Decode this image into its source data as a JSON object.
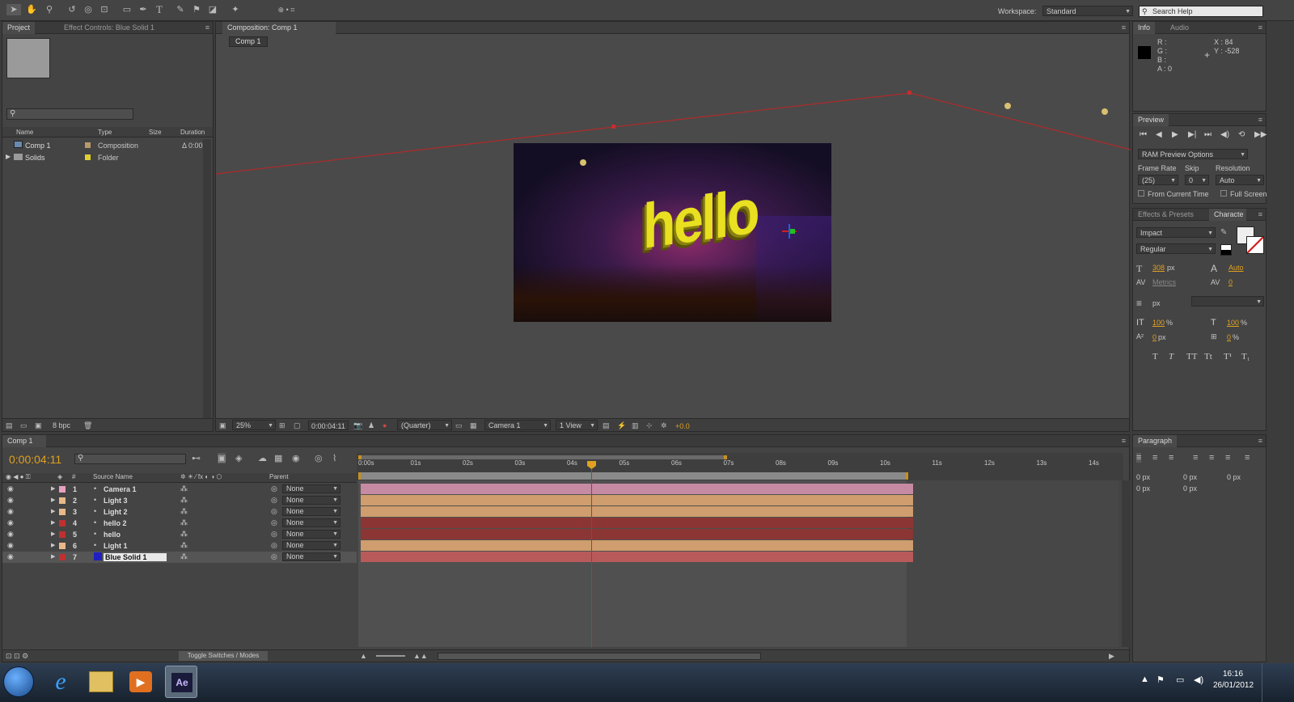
{
  "workspace": {
    "label": "Workspace:",
    "value": "Standard",
    "search_placeholder": "Search Help"
  },
  "project_panel": {
    "tabs": [
      "Project",
      "Effect Controls: Blue Solid 1"
    ],
    "columns": [
      "Name",
      "Type",
      "Size",
      "Duration"
    ],
    "items": [
      {
        "name": "Comp 1",
        "type": "Composition",
        "duration": "Δ 0:00"
      },
      {
        "name": "Solids",
        "type": "Folder",
        "duration": ""
      }
    ],
    "bpc": "8 bpc"
  },
  "composition_panel": {
    "tab": "Composition: Comp 1",
    "sub_tab": "Comp 1",
    "zoom": "25%",
    "timecode": "0:00:04:11",
    "resolution": "(Quarter)",
    "camera": "Camera 1",
    "views": "1 View",
    "exposure": "+0.0",
    "scene_text": "hello"
  },
  "info_panel": {
    "tabs": [
      "Info",
      "Audio"
    ],
    "r": "R :",
    "g": "G :",
    "b": "B :",
    "a": "A : 0",
    "x": "X : 84",
    "y": "Y : -528"
  },
  "preview_panel": {
    "tab": "Preview",
    "options": "RAM Preview Options",
    "frame_rate_label": "Frame Rate",
    "skip_label": "Skip",
    "resolution_label": "Resolution",
    "frame_rate": "(25)",
    "skip": "0",
    "resolution": "Auto",
    "from_current": "From Current Time",
    "full_screen": "Full Screen"
  },
  "character_panel": {
    "tabs": [
      "Effects & Presets",
      "Characte"
    ],
    "font": "Impact",
    "style": "Regular",
    "size": "308",
    "size_unit": "px",
    "leading": "Auto",
    "kerning": "Metrics",
    "tracking": "0",
    "stroke_unit": "px",
    "vscale": "100",
    "vscale_unit": "%",
    "hscale": "100",
    "hscale_unit": "%",
    "baseline": "0",
    "baseline_unit": "px",
    "tsume": "0",
    "tsume_unit": "%",
    "styles": [
      "T",
      "T",
      "TT",
      "Tt",
      "T¹",
      "T₁"
    ]
  },
  "paragraph_panel": {
    "tab": "Paragraph",
    "values": [
      "0 px",
      "0 px",
      "0 px",
      "0 px",
      "0 px"
    ]
  },
  "timeline": {
    "tab": "Comp 1",
    "timecode": "0:00:04:11",
    "col_source": "Source Name",
    "col_parent": "Parent",
    "col_num": "#",
    "toggle_label": "Toggle Switches / Modes",
    "ruler": [
      "0:00s",
      "01s",
      "02s",
      "03s",
      "04s",
      "05s",
      "06s",
      "07s",
      "08s",
      "09s",
      "10s",
      "11s",
      "12s",
      "13s",
      "14s"
    ],
    "layers": [
      {
        "num": "1",
        "name": "Camera 1",
        "label_color": "#e8a0c0",
        "bar_color": "#c78aa3",
        "parent": "None"
      },
      {
        "num": "2",
        "name": "Light 3",
        "label_color": "#e8b888",
        "bar_color": "#cf9d6e",
        "parent": "None"
      },
      {
        "num": "3",
        "name": "Light 2",
        "label_color": "#e8b888",
        "bar_color": "#cf9d6e",
        "parent": "None"
      },
      {
        "num": "4",
        "name": "hello 2",
        "label_color": "#c03030",
        "bar_color": "#8c3535",
        "parent": "None"
      },
      {
        "num": "5",
        "name": "hello",
        "label_color": "#c03030",
        "bar_color": "#8c3535",
        "parent": "None"
      },
      {
        "num": "6",
        "name": "Light 1",
        "label_color": "#e8b888",
        "bar_color": "#cf9d6e",
        "parent": "None"
      },
      {
        "num": "7",
        "name": "Blue Solid 1",
        "label_color": "#c03030",
        "bar_color": "#b85a5a",
        "parent": "None"
      }
    ]
  },
  "taskbar": {
    "time": "16:16",
    "date": "26/01/2012",
    "ae_label": "Ae"
  }
}
